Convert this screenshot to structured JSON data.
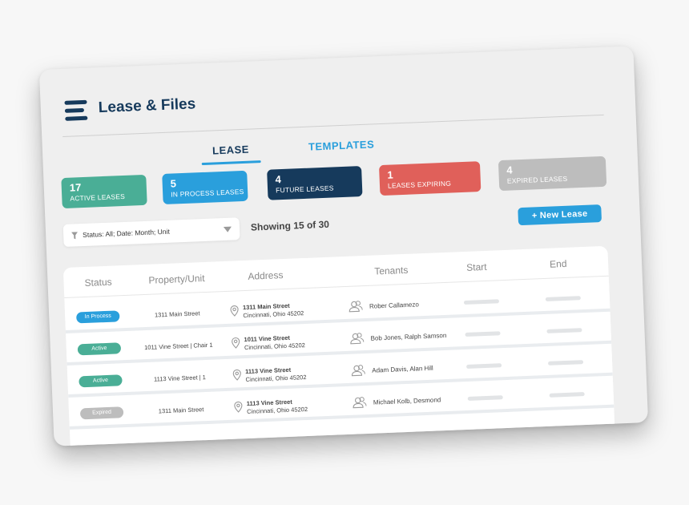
{
  "app": {
    "title": "Lease & Files"
  },
  "tabs": [
    {
      "label": "LEASE",
      "active": true
    },
    {
      "label": "TEMPLATES",
      "active": false
    }
  ],
  "stats": [
    {
      "count": "17",
      "label": "ACTIVE LEASES",
      "color": "#4aae96"
    },
    {
      "count": "5",
      "label": "IN PROCESS LEASES",
      "color": "#2a9fdc"
    },
    {
      "count": "4",
      "label": "FUTURE LEASES",
      "color": "#163a5c"
    },
    {
      "count": "1",
      "label": "LEASES EXPIRING",
      "color": "#e0605a"
    },
    {
      "count": "4",
      "label": "EXPIRED LEASES",
      "color": "#bdbdbd"
    }
  ],
  "filter": {
    "text": "Status: All; Date: Month; Unit",
    "icon": "filter-icon"
  },
  "showing": "Showing 15 of 30",
  "new_lease": "+ New Lease",
  "table": {
    "columns": [
      "Status",
      "Property/Unit",
      "Address",
      "Tenants",
      "Start",
      "End"
    ],
    "rows": [
      {
        "status": "In Process",
        "status_color": "#2a9fdc",
        "property": "1311 Main Street",
        "address_line1": "1311 Main Street",
        "address_line2": "Cincinnati, Ohio 45202",
        "tenants": "Rober Callamezo"
      },
      {
        "status": "Active",
        "status_color": "#4aae96",
        "property": "1011 Vine Street | Chair 1",
        "address_line1": "1011 Vine Street",
        "address_line2": "Cincinnati, Ohio 45202",
        "tenants": "Bob Jones, Ralph Samson"
      },
      {
        "status": "Active",
        "status_color": "#4aae96",
        "property": "1113 Vine Street | 1",
        "address_line1": "1113 Vine Street",
        "address_line2": "Cincinnati, Ohio 45202",
        "tenants": "Adam Davis, Alan Hill"
      },
      {
        "status": "Expired",
        "status_color": "#bdbdbd",
        "property": "1311 Main Street",
        "address_line1": "1113 Vine Street",
        "address_line2": "Cincinnati, Ohio 45202",
        "tenants": "Michael Kolb, Desmond"
      }
    ]
  },
  "colors": {
    "navy": "#163a5c",
    "blue": "#2a9fdc",
    "green": "#4aae96",
    "red": "#e0605a",
    "gray": "#bdbdbd"
  }
}
